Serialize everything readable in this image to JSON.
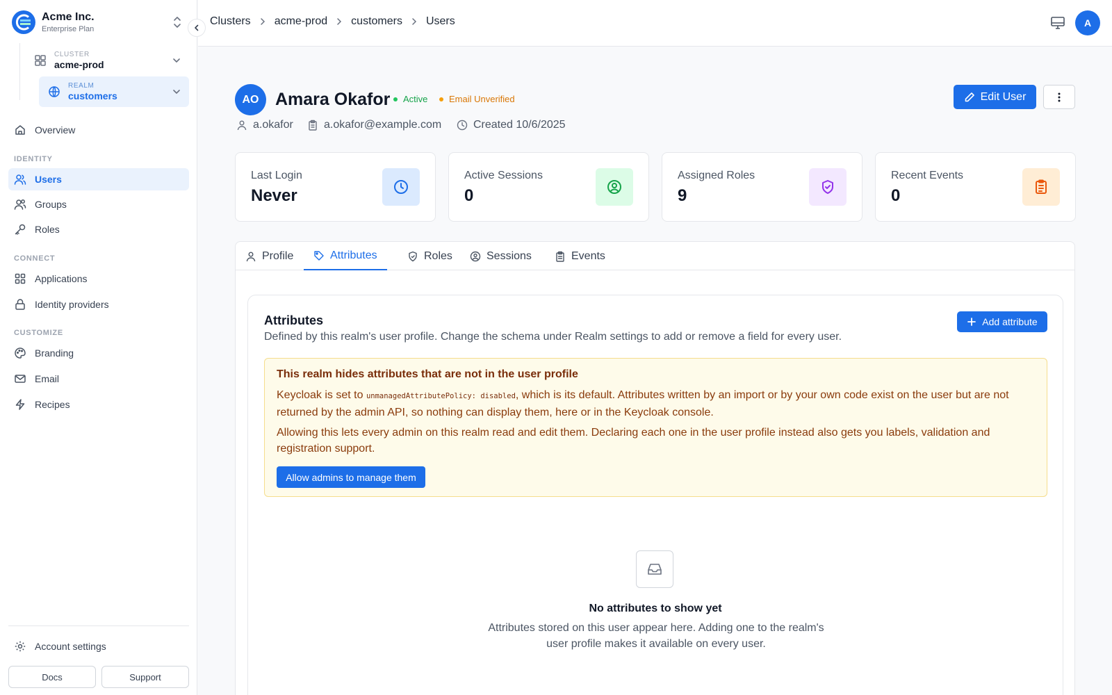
{
  "org": {
    "name": "Acme Inc.",
    "plan": "Enterprise Plan",
    "logo_icon": "acme-logo-icon"
  },
  "context": {
    "cluster": {
      "label": "CLUSTER",
      "value": "acme-prod"
    },
    "realm": {
      "label": "REALM",
      "value": "customers"
    }
  },
  "nav": {
    "overview": "Overview",
    "sections": {
      "identity": "IDENTITY",
      "connect": "CONNECT",
      "customize": "CUSTOMIZE"
    },
    "users": "Users",
    "groups": "Groups",
    "roles": "Roles",
    "applications": "Applications",
    "identity_providers": "Identity providers",
    "branding": "Branding",
    "email": "Email",
    "recipes": "Recipes",
    "account_settings": "Account settings",
    "docs": "Docs",
    "support": "Support"
  },
  "breadcrumb": [
    "Clusters",
    "acme-prod",
    "customers",
    "Users"
  ],
  "top": {
    "avatar_initial": "A"
  },
  "user": {
    "initials": "AO",
    "name": "Amara Okafor",
    "status": "Active",
    "email_status": "Email Unverified",
    "username": "a.okafor",
    "email": "a.okafor@example.com",
    "created": "Created 10/6/2025"
  },
  "actions": {
    "edit": "Edit User"
  },
  "stats": [
    {
      "label": "Last Login",
      "value": "Never",
      "icon": "clock-icon",
      "bg": "#dbeafe",
      "fg": "#1d6ee8"
    },
    {
      "label": "Active Sessions",
      "value": "0",
      "icon": "user-circle-icon",
      "bg": "#dcfce7",
      "fg": "#16a34a"
    },
    {
      "label": "Assigned Roles",
      "value": "9",
      "icon": "shield-check-icon",
      "bg": "#f3e8ff",
      "fg": "#9333ea"
    },
    {
      "label": "Recent Events",
      "value": "0",
      "icon": "clipboard-list-icon",
      "bg": "#ffedd5",
      "fg": "#ea580c"
    }
  ],
  "tabs": [
    "Profile",
    "Attributes",
    "Roles",
    "Sessions",
    "Events"
  ],
  "active_tab": "Attributes",
  "attributes": {
    "title": "Attributes",
    "description": "Defined by this realm's user profile. Change the schema under Realm settings to add or remove a field for every user.",
    "add_button": "Add attribute",
    "warning": {
      "title": "This realm hides attributes that are not in the user profile",
      "p1_before": "Keycloak is set to ",
      "p1_code": "unmanagedAttributePolicy: disabled",
      "p1_after": ", which is its default. Attributes written by an import or by your own code exist on the user but are not returned by the admin API, so nothing can display them, here or in the Keycloak console.",
      "p2": "Allowing this lets every admin on this realm read and edit them. Declaring each one in the user profile instead also gets you labels, validation and registration support.",
      "button": "Allow admins to manage them"
    },
    "empty": {
      "title": "No attributes to show yet",
      "description": "Attributes stored on this user appear here. Adding one to the realm's user profile makes it available on every user."
    }
  },
  "colors": {
    "accent": "#1d6ee8",
    "active": "#16a34a",
    "warning": "#d97706"
  }
}
